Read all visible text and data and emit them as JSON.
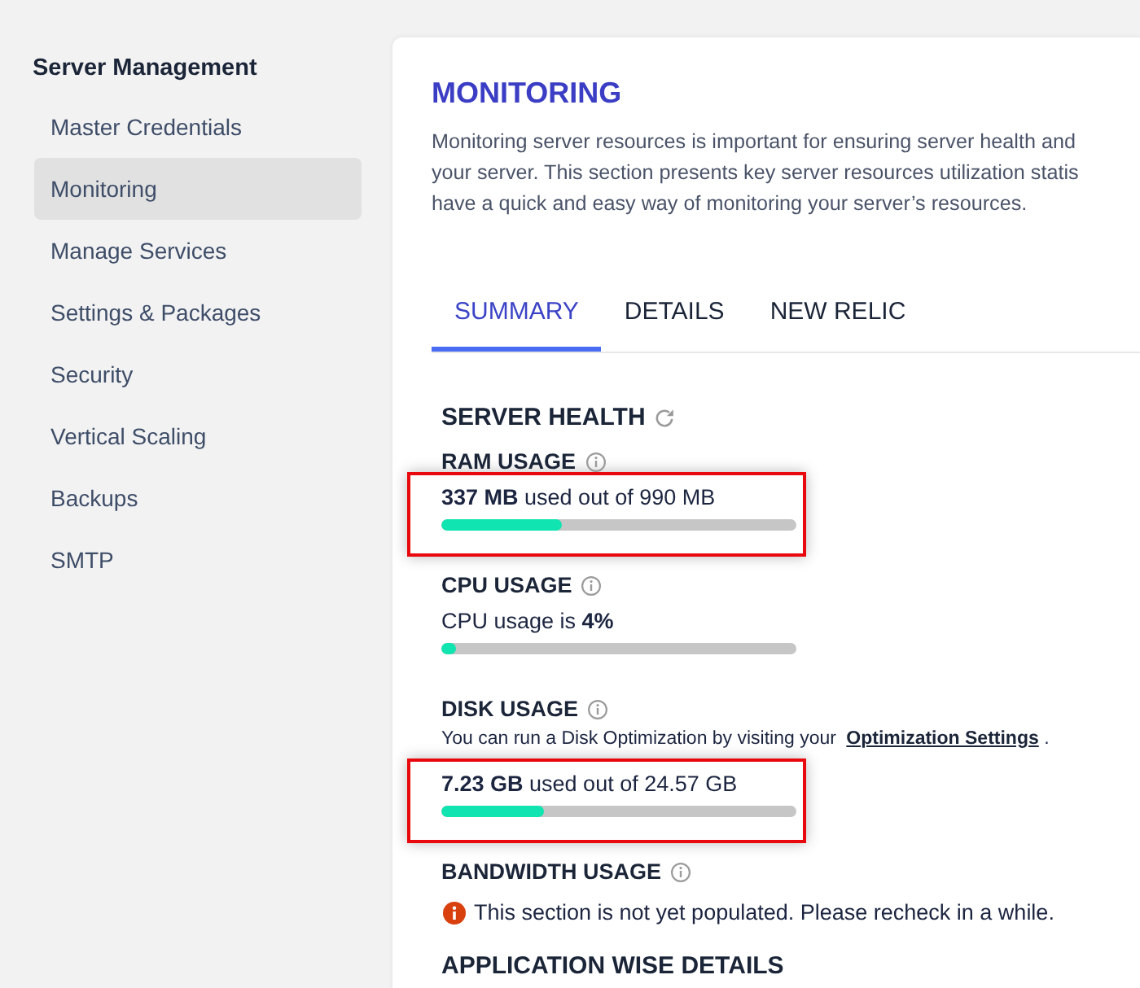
{
  "sidebar": {
    "heading": "Server Management",
    "items": [
      {
        "label": "Master Credentials",
        "selected": false
      },
      {
        "label": "Monitoring",
        "selected": true
      },
      {
        "label": "Manage Services",
        "selected": false
      },
      {
        "label": "Settings & Packages",
        "selected": false
      },
      {
        "label": "Security",
        "selected": false
      },
      {
        "label": "Vertical Scaling",
        "selected": false
      },
      {
        "label": "Backups",
        "selected": false
      },
      {
        "label": "SMTP",
        "selected": false
      }
    ]
  },
  "page": {
    "title": "MONITORING",
    "description": "Monitoring server resources is important for ensuring server health and\nyour server. This section presents key server resources utilization statis\nhave a quick and easy way of monitoring your server’s resources."
  },
  "tabs": [
    {
      "label": "SUMMARY",
      "selected": true
    },
    {
      "label": "DETAILS",
      "selected": false
    },
    {
      "label": "NEW RELIC",
      "selected": false
    }
  ],
  "server_health": {
    "title": "SERVER HEALTH",
    "metrics": [
      {
        "kind": "usage",
        "title": "RAM USAGE",
        "reading": "**337 MB** used out of 990 MB",
        "level": 0.34,
        "highlighted": true
      },
      {
        "kind": "usage",
        "title": "CPU USAGE",
        "reading": "CPU usage is **4%**",
        "level": 0.04,
        "highlighted": false
      },
      {
        "kind": "usage",
        "title": "DISK USAGE",
        "note": {
          "text": "You can run a Disk Optimization by visiting your",
          "link": "Optimization Settings",
          "end": "."
        },
        "reading": "**7.23 GB** used out of 24.57 GB",
        "level": 0.29,
        "highlighted": true
      },
      {
        "kind": "notice",
        "title": "BANDWIDTH USAGE",
        "message": "This section is not yet populated. Please recheck in a while."
      }
    ]
  },
  "next_section": {
    "title": "APPLICATION WISE DETAILS"
  }
}
